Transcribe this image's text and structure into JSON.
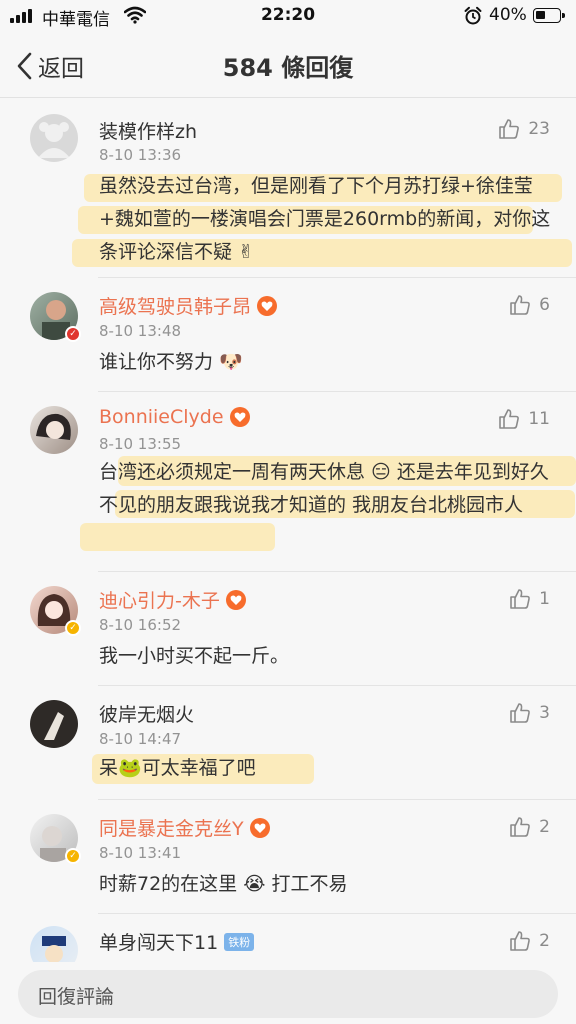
{
  "status_bar": {
    "carrier": "中華電信",
    "time": "22:20",
    "battery": "40%"
  },
  "nav": {
    "back_label": "返回",
    "title": "584 條回復"
  },
  "comments": [
    {
      "name": "装模作样zh",
      "time": "8-10 13:36",
      "likes": "23",
      "text": "虽然没去过台湾，但是刚看了下个月苏打绿+徐佳莹+魏如萱的一楼演唱会门票是260rmb的新闻，对你这条评论深信不疑 ✌"
    },
    {
      "name": "高级驾驶员韩子昂",
      "time": "8-10 13:48",
      "likes": "6",
      "text": "谁让你不努力 🐶"
    },
    {
      "name": "BonniieClyde",
      "time": "8-10 13:55",
      "likes": "11",
      "text": "台湾还必须规定一周有两天休息 😑 还是去年见到好久不见的朋友跟我说我才知道的 我朋友台北桃园市人"
    },
    {
      "name": "迪心引力-木子",
      "time": "8-10 16:52",
      "likes": "1",
      "text": "我一小时买不起一斤。"
    },
    {
      "name": "彼岸无烟火",
      "time": "8-10 14:47",
      "likes": "3",
      "text": "呆🐸可太幸福了吧"
    },
    {
      "name": "同是暴走金克丝Y",
      "time": "8-10 13:41",
      "likes": "2",
      "text": "时薪72的在这里 😭 打工不易"
    },
    {
      "name": "单身闯天下11",
      "tag": "铁粉",
      "likes": "2"
    }
  ],
  "reply": {
    "placeholder": "回復評論"
  },
  "colors": {
    "vip_name": "#eb7350",
    "highlight": "#ffe28c",
    "tag_bg": "#7cb3ea"
  }
}
